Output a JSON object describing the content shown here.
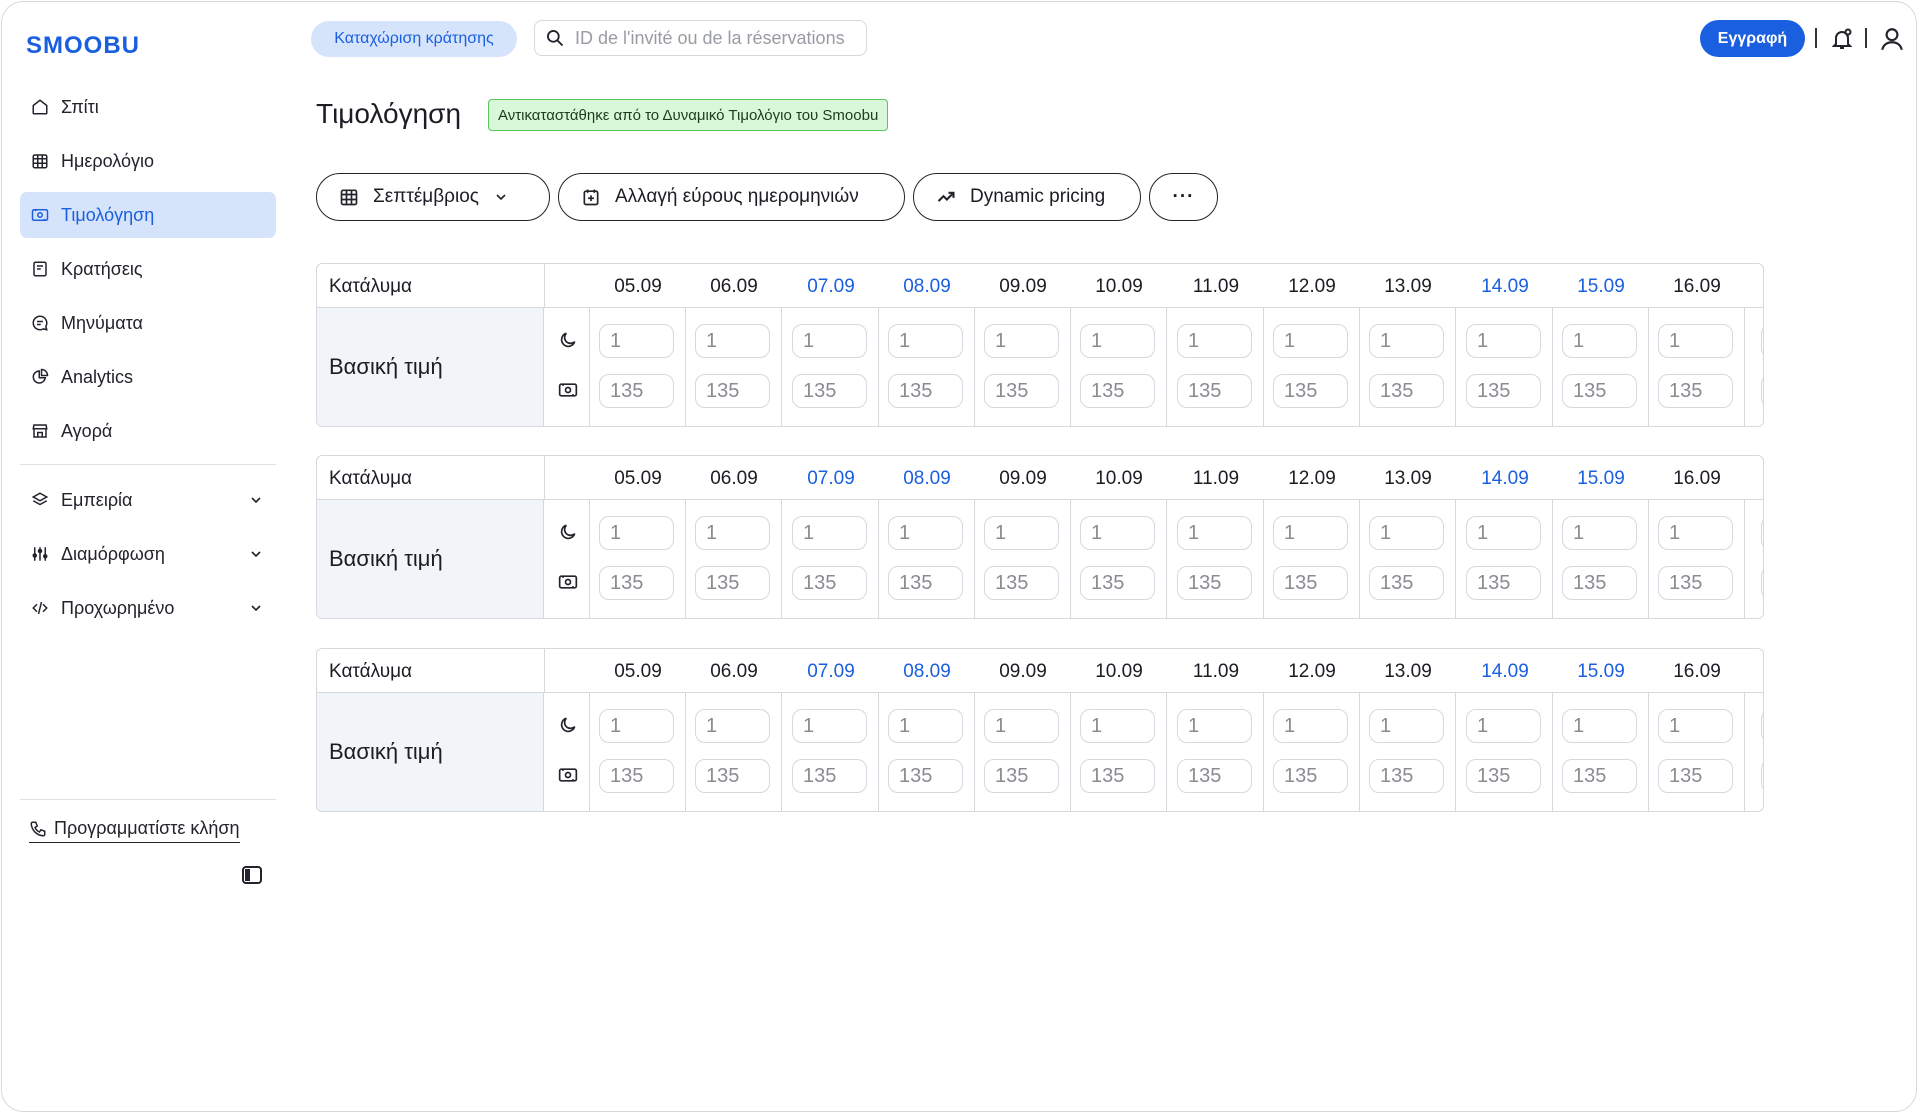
{
  "app": {
    "logo": "SMOOBU"
  },
  "sidebar": {
    "items": [
      {
        "label": "Σπίτι",
        "icon": "home-icon"
      },
      {
        "label": "Ημερολόγιο",
        "icon": "calendar-icon"
      },
      {
        "label": "Τιμολόγηση",
        "icon": "pricing-icon",
        "active": true
      },
      {
        "label": "Κρατήσεις",
        "icon": "bookings-icon"
      },
      {
        "label": "Μηνύματα",
        "icon": "messages-icon"
      },
      {
        "label": "Analytics",
        "icon": "analytics-icon"
      },
      {
        "label": "Αγορά",
        "icon": "store-icon"
      }
    ],
    "expandable": [
      {
        "label": "Εμπειρία",
        "icon": "layers-icon"
      },
      {
        "label": "Διαμόρφωση",
        "icon": "sliders-icon"
      },
      {
        "label": "Προχωρημένο",
        "icon": "code-icon"
      }
    ],
    "call_link": "Προγραμματίστε κλήση"
  },
  "topbar": {
    "new_booking": "Καταχώριση κράτησης",
    "search_placeholder": "ID de l'invité ou de la réservations",
    "register": "Εγγραφή"
  },
  "header": {
    "title": "Τιμολόγηση",
    "badge": "Αντικαταστάθηκε από το Δυναμικό Τιμολόγιο του Smoobu"
  },
  "toolbar": {
    "month": "Σεπτέμβριος",
    "date_range": "Αλλαγή εύρους ημερομηνιών",
    "dynamic": "Dynamic pricing",
    "more": "···"
  },
  "tables": [
    {
      "header": "Κατάλυμα",
      "row_label": "Βασική τιμή",
      "dates": [
        "05.09",
        "06.09",
        "07.09",
        "08.09",
        "09.09",
        "10.09",
        "11.09",
        "12.09",
        "13.09",
        "14.09",
        "15.09",
        "16.09"
      ],
      "weekend": [
        false,
        false,
        true,
        true,
        false,
        false,
        false,
        false,
        false,
        true,
        true,
        false
      ],
      "min_stay": [
        "1",
        "1",
        "1",
        "1",
        "1",
        "1",
        "1",
        "1",
        "1",
        "1",
        "1",
        "1"
      ],
      "price": [
        "135",
        "135",
        "135",
        "135",
        "135",
        "135",
        "135",
        "135",
        "135",
        "135",
        "135",
        "135"
      ]
    },
    {
      "header": "Κατάλυμα",
      "row_label": "Βασική τιμή",
      "dates": [
        "05.09",
        "06.09",
        "07.09",
        "08.09",
        "09.09",
        "10.09",
        "11.09",
        "12.09",
        "13.09",
        "14.09",
        "15.09",
        "16.09"
      ],
      "weekend": [
        false,
        false,
        true,
        true,
        false,
        false,
        false,
        false,
        false,
        true,
        true,
        false
      ],
      "min_stay": [
        "1",
        "1",
        "1",
        "1",
        "1",
        "1",
        "1",
        "1",
        "1",
        "1",
        "1",
        "1"
      ],
      "price": [
        "135",
        "135",
        "135",
        "135",
        "135",
        "135",
        "135",
        "135",
        "135",
        "135",
        "135",
        "135"
      ]
    },
    {
      "header": "Κατάλυμα",
      "row_label": "Βασική τιμή",
      "dates": [
        "05.09",
        "06.09",
        "07.09",
        "08.09",
        "09.09",
        "10.09",
        "11.09",
        "12.09",
        "13.09",
        "14.09",
        "15.09",
        "16.09"
      ],
      "weekend": [
        false,
        false,
        true,
        true,
        false,
        false,
        false,
        false,
        false,
        true,
        true,
        false
      ],
      "min_stay": [
        "1",
        "1",
        "1",
        "1",
        "1",
        "1",
        "1",
        "1",
        "1",
        "1",
        "1",
        "1"
      ],
      "price": [
        "135",
        "135",
        "135",
        "135",
        "135",
        "135",
        "135",
        "135",
        "135",
        "135",
        "135",
        "135"
      ]
    }
  ],
  "colors": {
    "accent": "#1a5fe0",
    "active_bg": "#d6e4fb",
    "badge_bg": "#d9f7d9",
    "badge_border": "#5bc45b"
  }
}
